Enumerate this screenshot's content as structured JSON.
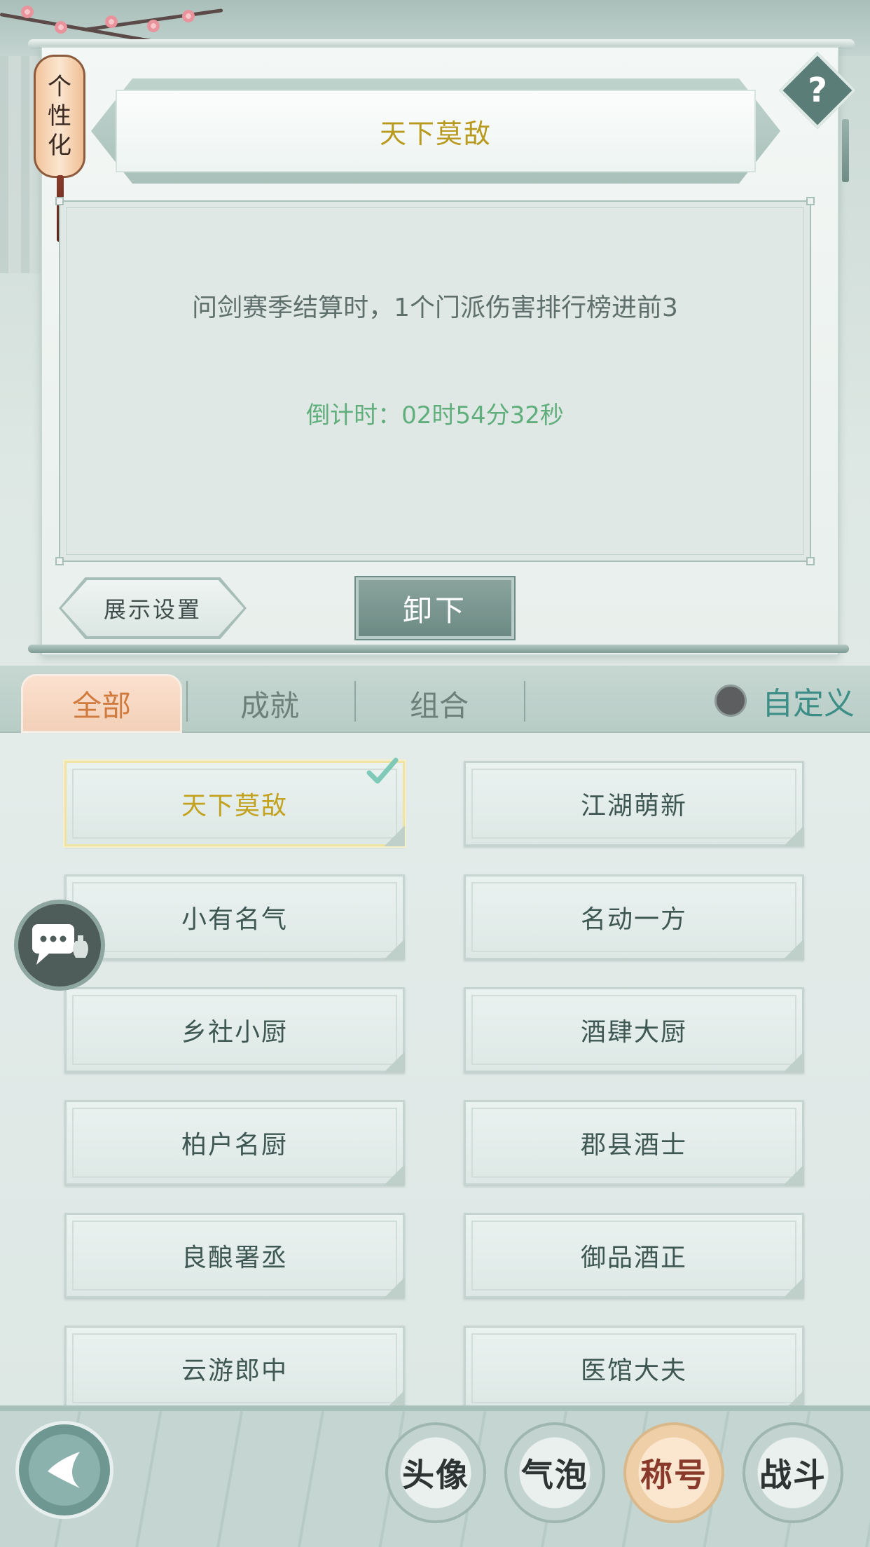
{
  "header": {
    "lantern_chars": [
      "个",
      "性",
      "化"
    ],
    "selected_title": "天下莫敌",
    "help_label": "?"
  },
  "detail": {
    "description": "问剑赛季结算时，1个门派伤害排行榜进前3",
    "countdown": "倒计时：02时54分32秒"
  },
  "actions": {
    "display_settings": "展示设置",
    "unload": "卸下"
  },
  "tabs": [
    {
      "label": "全部",
      "active": true
    },
    {
      "label": "成就",
      "active": false
    },
    {
      "label": "组合",
      "active": false
    }
  ],
  "custom": {
    "label": "自定义",
    "enabled": false
  },
  "titles": [
    {
      "label": "天下莫敌",
      "selected": true
    },
    {
      "label": "江湖萌新",
      "selected": false
    },
    {
      "label": "小有名气",
      "selected": false
    },
    {
      "label": "名动一方",
      "selected": false
    },
    {
      "label": "乡社小厨",
      "selected": false
    },
    {
      "label": "酒肆大厨",
      "selected": false
    },
    {
      "label": "柏户名厨",
      "selected": false
    },
    {
      "label": "郡县酒士",
      "selected": false
    },
    {
      "label": "良酿署丞",
      "selected": false
    },
    {
      "label": "御品酒正",
      "selected": false
    },
    {
      "label": "云游郎中",
      "selected": false
    },
    {
      "label": "医馆大夫",
      "selected": false
    }
  ],
  "bottom_nav": [
    {
      "label": "头像",
      "active": false
    },
    {
      "label": "气泡",
      "active": false
    },
    {
      "label": "称号",
      "active": true
    },
    {
      "label": "战斗",
      "active": false
    }
  ],
  "colors": {
    "selected_title": "#c2a21f",
    "countdown": "#5fae7c",
    "active_tab": "#d07a3e",
    "custom_label": "#3c8e86"
  }
}
